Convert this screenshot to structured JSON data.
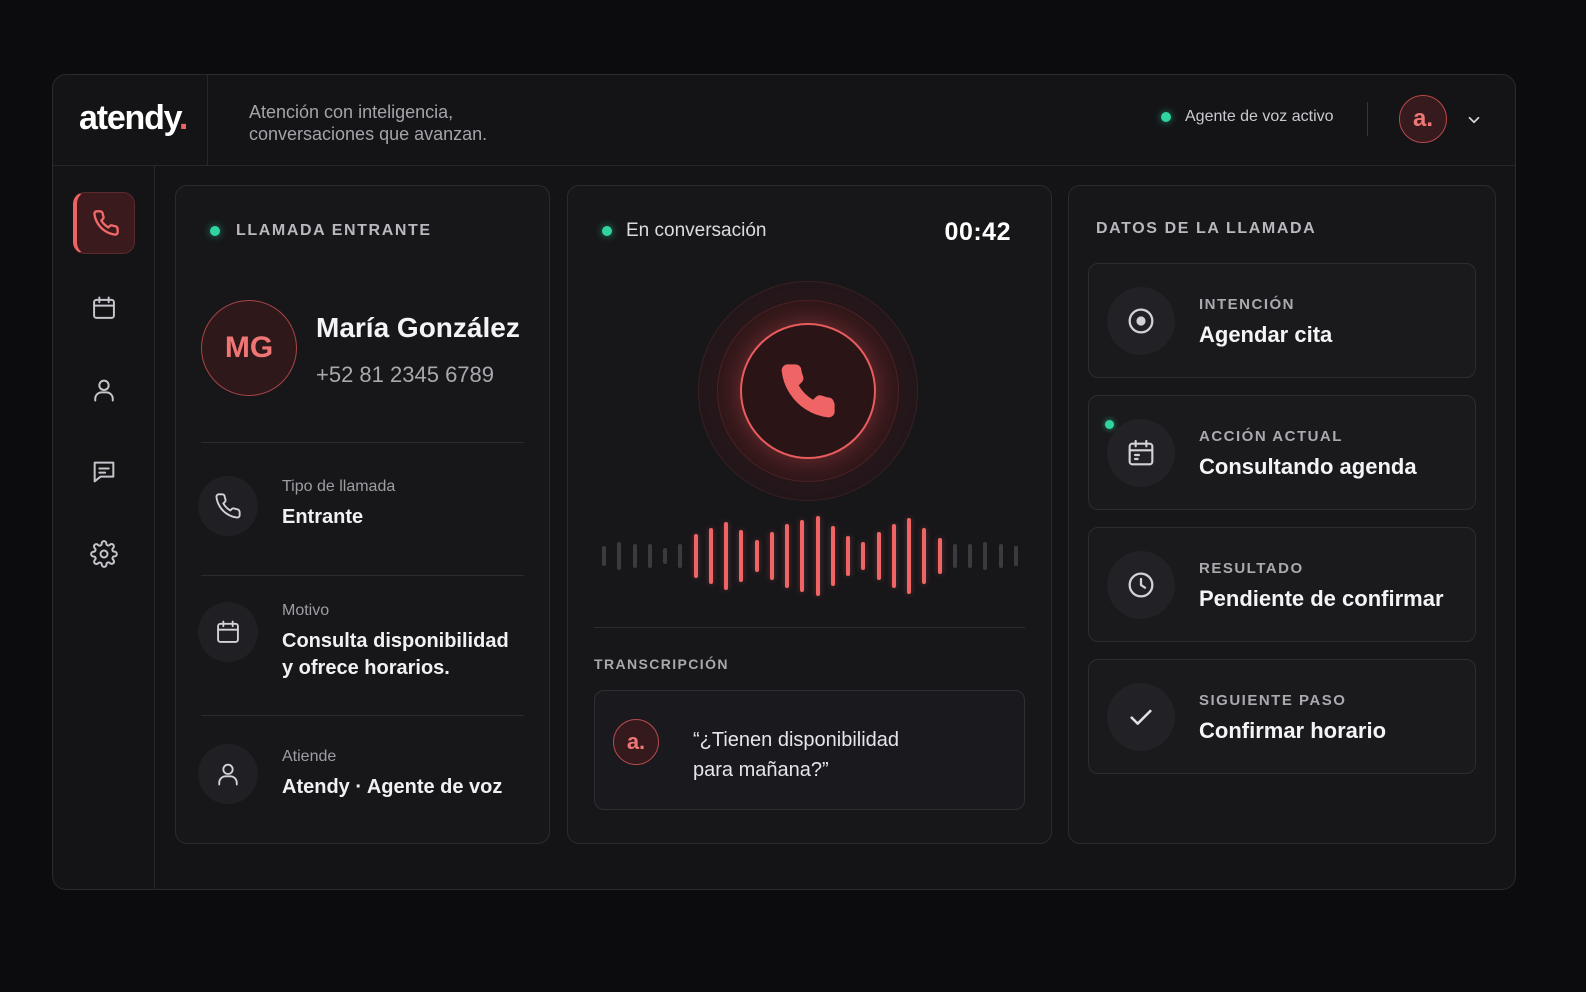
{
  "brand": {
    "name": "atendy",
    "dot": "."
  },
  "header": {
    "tagline_line1": "Atención con inteligencia,",
    "tagline_line2": "conversaciones que avanzan.",
    "status_text": "Agente de voz activo",
    "avatar_initial": "a."
  },
  "sidebar": {
    "items": [
      {
        "name": "phone",
        "active": true
      },
      {
        "name": "calendar",
        "active": false
      },
      {
        "name": "user",
        "active": false
      },
      {
        "name": "messages",
        "active": false
      },
      {
        "name": "settings",
        "active": false
      }
    ]
  },
  "incoming": {
    "title": "LLAMADA ENTRANTE",
    "initials": "MG",
    "name": "María González",
    "phone": "+52 81 2345 6789",
    "rows": [
      {
        "label": "Tipo de llamada",
        "value_line1": "Entrante",
        "value_line2": ""
      },
      {
        "label": "Motivo",
        "value_line1": "Consulta disponibilidad",
        "value_line2": "y ofrece horarios."
      },
      {
        "label": "Atiende",
        "value_line1": "Atendy · Agente de voz",
        "value_line2": ""
      }
    ]
  },
  "conversation": {
    "status": "En conversación",
    "timer": "00:42",
    "transcript_label": "TRANSCRIPCIÓN",
    "transcript_avatar": "a.",
    "transcript_line1": "“¿Tienen disponibilidad",
    "transcript_line2": "para mañana?”",
    "waveform_levels": [
      0.25,
      0.35,
      0.3,
      0.3,
      0.2,
      0.3,
      0.55,
      0.7,
      0.85,
      0.65,
      0.4,
      0.6,
      0.8,
      0.9,
      1.0,
      0.75,
      0.5,
      0.35,
      0.6,
      0.8,
      0.95,
      0.7,
      0.45,
      0.3,
      0.3,
      0.35,
      0.3,
      0.25
    ],
    "waveform_active_range": [
      6,
      22
    ]
  },
  "call_data": {
    "title": "DATOS DE LA LLAMADA",
    "items": [
      {
        "label": "INTENCIÓN",
        "value": "Agendar cita",
        "icon": "target-icon"
      },
      {
        "label": "ACCIÓN ACTUAL",
        "value": "Consultando agenda",
        "icon": "calendar-icon"
      },
      {
        "label": "RESULTADO",
        "value": "Pendiente de confirmar",
        "icon": "clock-icon"
      },
      {
        "label": "SIGUIENTE PASO",
        "value": "Confirmar horario",
        "icon": "check-icon"
      }
    ]
  },
  "colors": {
    "accent": "#ef6565",
    "status_green": "#2fd4a0",
    "background": "#0c0c0e",
    "panel": "#17171a"
  }
}
